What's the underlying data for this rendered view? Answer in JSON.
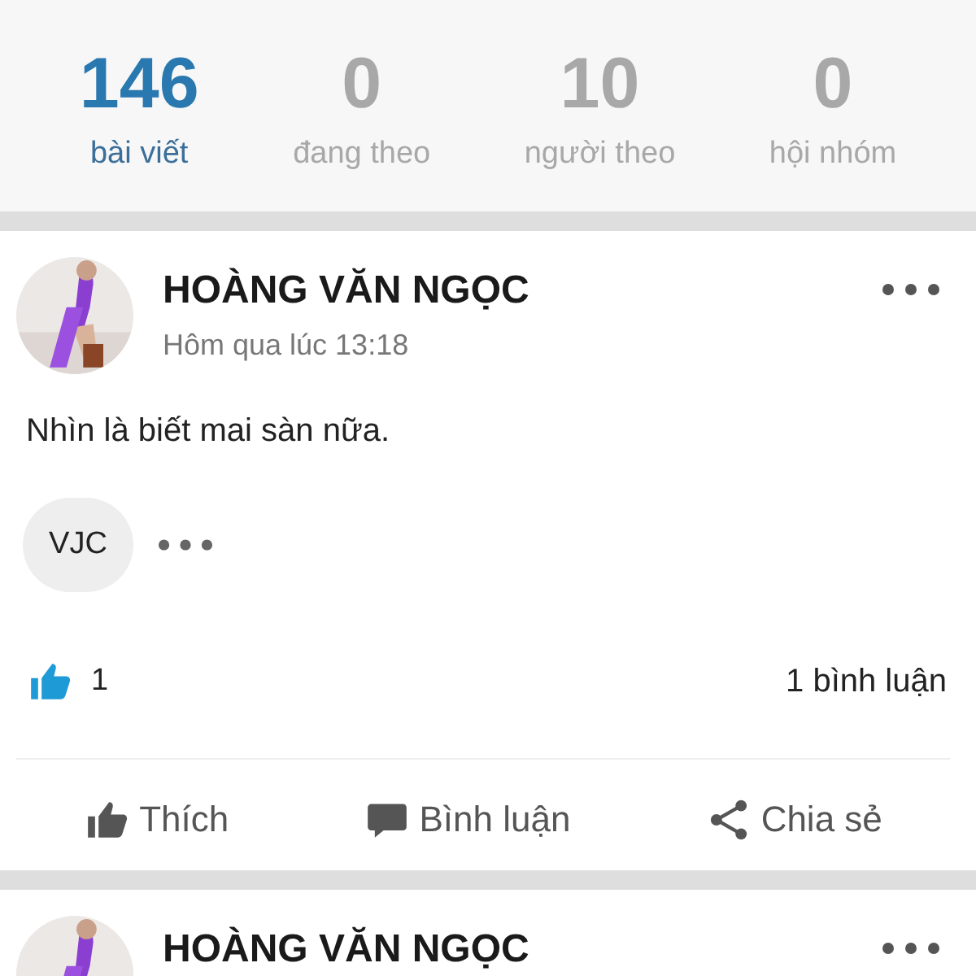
{
  "stats": [
    {
      "value": "146",
      "label": "bài viết",
      "selected": true
    },
    {
      "value": "0",
      "label": "đang theo",
      "selected": false
    },
    {
      "value": "10",
      "label": "người theo",
      "selected": false
    },
    {
      "value": "0",
      "label": "hội nhóm",
      "selected": false
    }
  ],
  "posts": [
    {
      "author": "HOÀNG VĂN NGỌC",
      "time": "Hôm qua lúc 13:18",
      "text": "Nhìn là biết mai sàn nữa.",
      "tags": [
        "VJC"
      ],
      "likes": "1",
      "comments": "1 bình luận",
      "actions": [
        {
          "kind": "like",
          "label": "Thích"
        },
        {
          "kind": "comment",
          "label": "Bình luận"
        },
        {
          "kind": "share",
          "label": "Chia sẻ"
        }
      ]
    },
    {
      "author": "HOÀNG VĂN NGỌC"
    }
  ]
}
